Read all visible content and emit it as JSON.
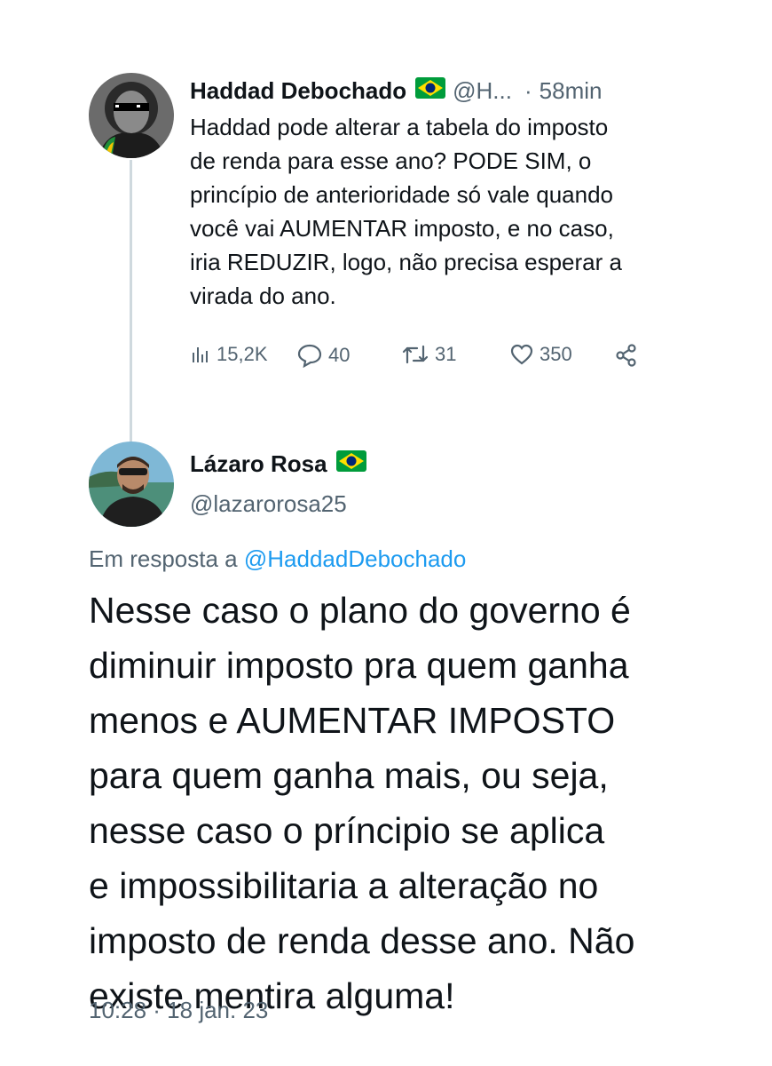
{
  "tweet1": {
    "author_name": "Haddad Debochado",
    "author_flag": "brazil-flag-emoji",
    "handle_truncated": "@H...",
    "separator": "·",
    "time": "58min",
    "text": "Haddad pode alterar a tabela do imposto\nde renda para esse ano? PODE SIM, o\nprincípio de anterioridade só vale quando\nvocê vai AUMENTAR imposto, e no caso,\niria REDUZIR, logo, não precisa esperar a\nvirada do ano.",
    "stats": {
      "views": "15,2K",
      "replies": "40",
      "retweets": "31",
      "likes": "350"
    }
  },
  "tweet2": {
    "author_name": "Lázaro Rosa",
    "author_flag": "brazil-flag-emoji",
    "handle": "@lazarorosa25",
    "reply_prefix": "Em resposta a",
    "reply_handle": "@HaddadDebochado",
    "text": "Nesse caso o plano do governo é\ndiminuir imposto pra quem ganha\nmenos e AUMENTAR IMPOSTO\npara quem ganha mais, ou seja,\nnesse caso o príncipio se aplica\ne impossibilitaria a alteração no\nimposto de renda desse ano. Não\nexiste mentira alguma!",
    "timestamp": "10:28 · 18 jan. 23"
  },
  "colors": {
    "text_primary": "#0f1419",
    "text_secondary": "#536471",
    "link": "#1d9bf0",
    "thread_line": "#cfd9de",
    "flag_green": "#009c3b",
    "flag_yellow": "#ffdf00",
    "flag_blue": "#002776"
  }
}
